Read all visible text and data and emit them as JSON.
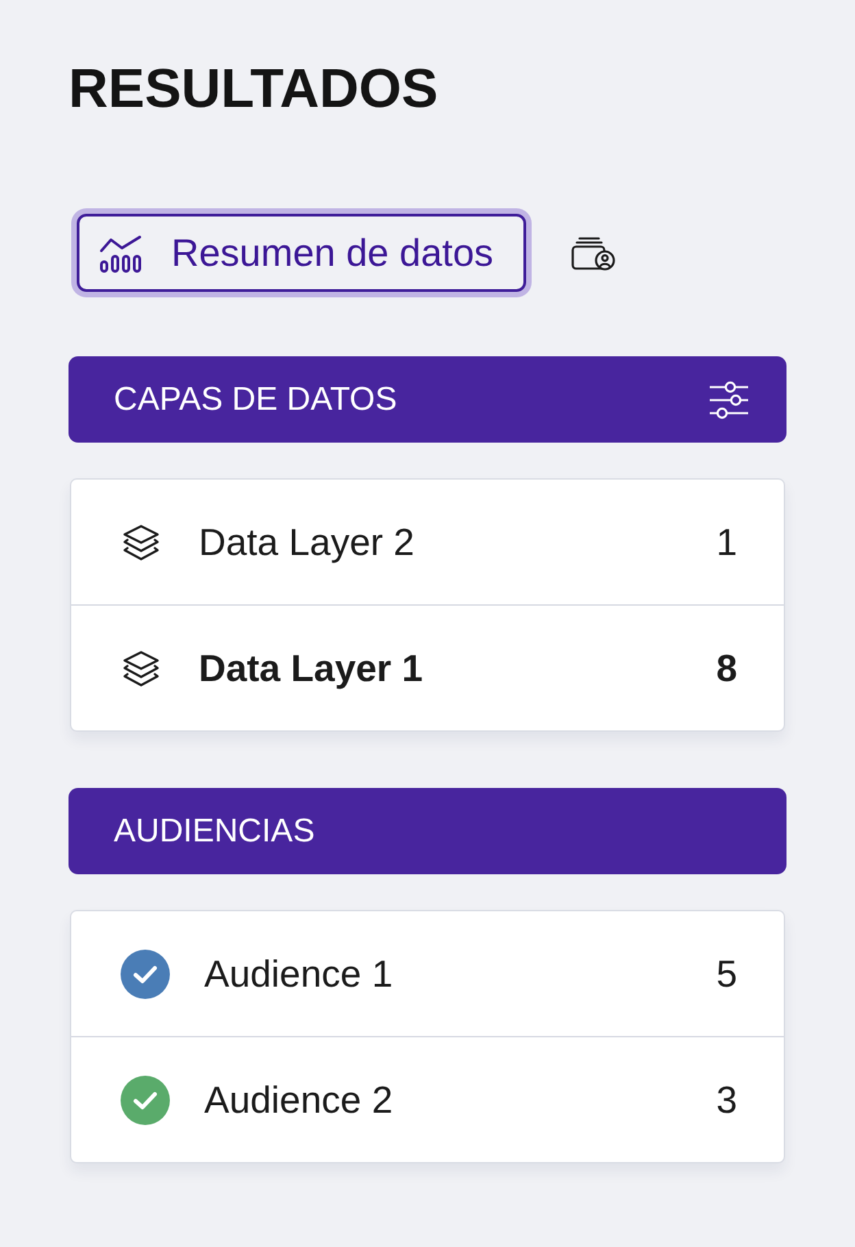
{
  "title": "RESULTADOS",
  "view_tabs": [
    {
      "kind": "summary",
      "label": "Resumen de datos",
      "selected": true
    },
    {
      "kind": "audience",
      "selected": false
    }
  ],
  "sections": [
    {
      "kind": "layers",
      "title": "CAPAS DE DATOS",
      "filter": true,
      "items": [
        {
          "name": "Data Layer 2",
          "count": "1",
          "selected": false
        },
        {
          "name": "Data Layer 1",
          "count": "8",
          "selected": true
        }
      ]
    },
    {
      "kind": "audiences",
      "title": "AUDIENCIAS",
      "filter": false,
      "items": [
        {
          "name": "Audience 1",
          "count": "5",
          "color": "#4a7db6"
        },
        {
          "name": "Audience 2",
          "count": "3",
          "color": "#5aab6b"
        }
      ]
    }
  ]
}
